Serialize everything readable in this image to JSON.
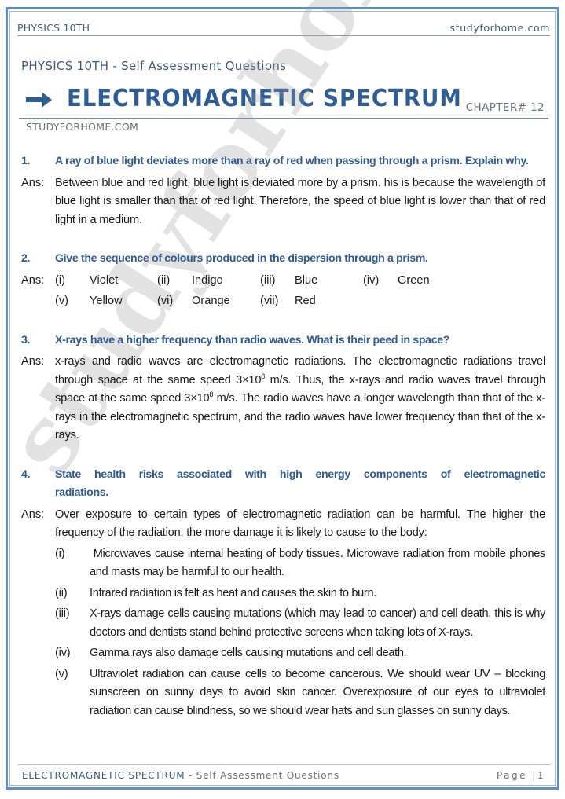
{
  "header": {
    "subject": "PHYSICS 10TH",
    "website": "studyforhome.com"
  },
  "title_block": {
    "subtitle": "PHYSICS 10TH - Self Assessment Questions",
    "arrow_icon": "right-arrow-icon",
    "title": "ELECTROMAGNETIC SPECTRUM",
    "chapter": "CHAPTER# 12",
    "site_caps": "STUDYFORHOME.COM"
  },
  "watermark": "studyforhome.com",
  "colors": {
    "accent_blue": "#2e5d96",
    "question_blue": "#2f5a91",
    "border_blue": "#5b8dc9"
  },
  "questions": [
    {
      "number": "1.",
      "question": "A ray of blue light deviates more than a ray of red when passing through a prism. Explain why.",
      "answer_label": "Ans:",
      "answer": "Between blue and red light, blue light is deviated more by a prism. his is because the wavelength of blue light is smaller than that of red light. Therefore, the speed of blue light is lower than that of red light in a medium."
    },
    {
      "number": "2.",
      "question": "Give the sequence of colours produced in the dispersion through a prism.",
      "answer_label": "Ans:",
      "colours": [
        {
          "num": "(i)",
          "name": "Violet"
        },
        {
          "num": "(ii)",
          "name": "Indigo"
        },
        {
          "num": "(iii)",
          "name": "Blue"
        },
        {
          "num": "(iv)",
          "name": "Green"
        },
        {
          "num": "(v)",
          "name": "Yellow"
        },
        {
          "num": "(vi)",
          "name": "Orange"
        },
        {
          "num": "(vii)",
          "name": "Red"
        }
      ]
    },
    {
      "number": "3.",
      "question": "X-rays have a higher frequency than radio waves. What is their peed in space?",
      "answer_label": "Ans:",
      "answer_parts": {
        "p1": "x-rays and radio waves are electromagnetic radiations. The electromagnetic radiations travel through space at the same speed 3×10",
        "exp1": "8",
        "p2": " m/s. Thus, the x-rays and radio waves travel through space at the same speed 3×10",
        "exp2": "8",
        "p3": " m/s. The radio waves have a longer wavelength than that of the x-rays in the electromagnetic spectrum, and the radio waves have lower frequency than that of the x-rays."
      }
    },
    {
      "number": "4.",
      "question": "State health risks associated with high energy components of electromagnetic radiations.",
      "answer_label": "Ans:",
      "answer_intro": "Over exposure to certain types of electromagnetic radiation can be harmful. The higher the frequency of the radiation, the more damage it is likely to cause to the body:",
      "items": [
        {
          "num": "(i)",
          "text": " Microwaves cause internal heating of body tissues. Microwave radiation from mobile phones and masts may be harmful to our health."
        },
        {
          "num": "(ii)",
          "text": "Infrared radiation is felt as heat and causes the skin to burn."
        },
        {
          "num": "(iii)",
          "text": "X-rays damage cells causing mutations (which may lead to cancer) and cell death, this is why doctors and dentists stand behind protective screens when taking lots of X-rays."
        },
        {
          "num": "(iv)",
          "text": "Gamma rays also damage cells causing mutations and cell death."
        },
        {
          "num": "(v)",
          "text": "Ultraviolet radiation can cause cells to become cancerous. We should wear UV – blocking sunscreen on sunny days to avoid skin cancer. Overexposure of our eyes to ultraviolet radiation can cause blindness, so we should wear hats and sun glasses on sunny days."
        }
      ]
    }
  ],
  "footer": {
    "title": "ELECTROMAGNETIC SPECTRUM",
    "separator": " - ",
    "subtitle": "Self Assessment Questions",
    "page_label": "Page",
    "page_number": "1"
  }
}
